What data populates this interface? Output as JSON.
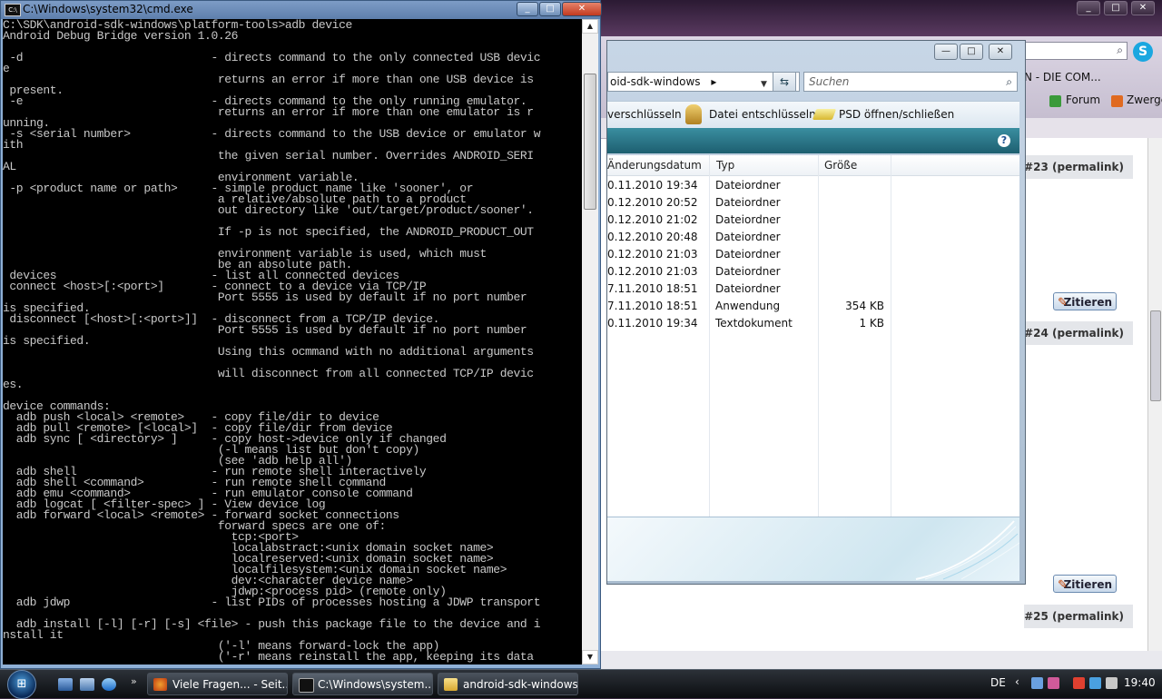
{
  "cmd": {
    "title": "C:\\Windows\\system32\\cmd.exe",
    "console_text": "C:\\SDK\\android-sdk-windows\\platform-tools>adb device\nAndroid Debug Bridge version 1.0.26\n\n -d                            - directs command to the only connected USB devic\ne\n                                returns an error if more than one USB device is\n present.\n -e                            - directs command to the only running emulator.\n                                returns an error if more than one emulator is r\nunning.\n -s <serial number>            - directs command to the USB device or emulator w\nith\n                                the given serial number. Overrides ANDROID_SERI\nAL\n                                environment variable.\n -p <product name or path>     - simple product name like 'sooner', or\n                                a relative/absolute path to a product\n                                out directory like 'out/target/product/sooner'.\n\n                                If -p is not specified, the ANDROID_PRODUCT_OUT\n\n                                environment variable is used, which must\n                                be an absolute path.\n devices                       - list all connected devices\n connect <host>[:<port>]       - connect to a device via TCP/IP\n                                Port 5555 is used by default if no port number\nis specified.\n disconnect [<host>[:<port>]]  - disconnect from a TCP/IP device.\n                                Port 5555 is used by default if no port number\nis specified.\n                                Using this ocmmand with no additional arguments\n\n                                will disconnect from all connected TCP/IP devic\nes.\n\ndevice commands:\n  adb push <local> <remote>    - copy file/dir to device\n  adb pull <remote> [<local>]  - copy file/dir from device\n  adb sync [ <directory> ]     - copy host->device only if changed\n                                (-l means list but don't copy)\n                                (see 'adb help all')\n  adb shell                    - run remote shell interactively\n  adb shell <command>          - run remote shell command\n  adb emu <command>            - run emulator console command\n  adb logcat [ <filter-spec> ] - View device log\n  adb forward <local> <remote> - forward socket connections\n                                forward specs are one of:\n                                  tcp:<port>\n                                  localabstract:<unix domain socket name>\n                                  localreserved:<unix domain socket name>\n                                  localfilesystem:<unix domain socket name>\n                                  dev:<character device name>\n                                  jdwp:<process pid> (remote only)\n  adb jdwp                     - list PIDs of processes hosting a JDWP transport\n\n  adb install [-l] [-r] [-s] <file> - push this package file to the device and i\nnstall it\n                                ('-l' means forward-lock the app)\n                                ('-r' means reinstall the app, keeping its data"
  },
  "explorer": {
    "address": "oid-sdk-windows",
    "address_chevron": "▸",
    "search_placeholder": "Suchen",
    "toolbar": {
      "encrypt": "verschlüsseln",
      "decrypt": "Datei entschlüsseln",
      "psd": "PSD öffnen/schließen"
    },
    "help": "?",
    "columns": [
      "Änderungsdatum",
      "Typ",
      "Größe"
    ],
    "rows": [
      {
        "date": "0.11.2010 19:34",
        "type": "Dateiordner",
        "size": ""
      },
      {
        "date": "0.12.2010 20:52",
        "type": "Dateiordner",
        "size": ""
      },
      {
        "date": "0.12.2010 21:02",
        "type": "Dateiordner",
        "size": ""
      },
      {
        "date": "0.12.2010 20:48",
        "type": "Dateiordner",
        "size": ""
      },
      {
        "date": "0.12.2010 21:03",
        "type": "Dateiordner",
        "size": ""
      },
      {
        "date": "0.12.2010 21:03",
        "type": "Dateiordner",
        "size": ""
      },
      {
        "date": "7.11.2010 18:51",
        "type": "Dateiordner",
        "size": ""
      },
      {
        "date": "7.11.2010 18:51",
        "type": "Anwendung",
        "size": "354 KB"
      },
      {
        "date": "0.11.2010 19:34",
        "type": "Textdokument",
        "size": "1 KB"
      }
    ]
  },
  "browser": {
    "bookmark_text": "N - DIE COM...",
    "bookmarks": [
      "Forum",
      "Zwerge"
    ],
    "posts": [
      "#23 (permalink)",
      "#24 (permalink)",
      "#25 (permalink)"
    ],
    "quote_button": "Zitieren"
  },
  "taskbar": {
    "quicklaunch_more": "»",
    "tasks": [
      "Viele Fragen... - Seit...",
      "C:\\Windows\\system...",
      "android-sdk-windows"
    ],
    "language": "DE",
    "clock": "19:40"
  },
  "colors": {
    "console_bg": "#000000",
    "console_text": "#c8c8c8",
    "explorer_infobar": "#2a7a8c",
    "taskbar": "#15181c"
  }
}
